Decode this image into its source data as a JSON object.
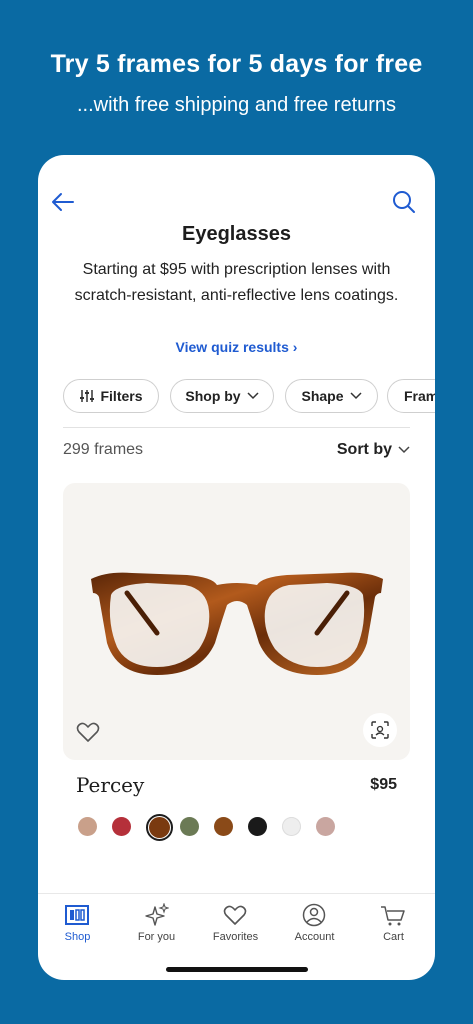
{
  "promo": {
    "title": "Try 5 frames for 5 days for free",
    "subtitle": "...with free shipping and free returns"
  },
  "header": {
    "back_icon": "arrow-left-icon",
    "search_icon": "search-icon",
    "title": "Eyeglasses",
    "description": "Starting at $95 with prescription lenses with scratch-resistant, anti-reflective lens coatings.",
    "quiz_link": "View quiz results ›"
  },
  "filters": {
    "chips": [
      {
        "label": "Filters",
        "icon": "sliders-icon"
      },
      {
        "label": "Shop by",
        "icon": "chevron-down-icon"
      },
      {
        "label": "Shape",
        "icon": "chevron-down-icon"
      },
      {
        "label": "Fram",
        "icon": ""
      }
    ]
  },
  "results": {
    "count": "299 frames",
    "sort_label": "Sort by"
  },
  "product": {
    "name": "Percey",
    "price": "$95",
    "swatches": [
      {
        "color": "#c9a08a"
      },
      {
        "color": "#b5303a"
      },
      {
        "color": "#7a3a10",
        "selected": true
      },
      {
        "color": "#6b7a55"
      },
      {
        "color": "#8a4a18"
      },
      {
        "color": "#1a1a1a"
      },
      {
        "color": "#eeeeee"
      },
      {
        "color": "#c9a6a0"
      }
    ]
  },
  "tabs": [
    {
      "label": "Shop",
      "icon": "shop-icon",
      "active": true
    },
    {
      "label": "For you",
      "icon": "sparkle-icon",
      "active": false
    },
    {
      "label": "Favorites",
      "icon": "heart-icon",
      "active": false
    },
    {
      "label": "Account",
      "icon": "account-icon",
      "active": false
    },
    {
      "label": "Cart",
      "icon": "cart-icon",
      "active": false
    }
  ],
  "colors": {
    "background": "#0a6aa3",
    "accent": "#1f5bd1",
    "card": "#f6f4f1"
  }
}
